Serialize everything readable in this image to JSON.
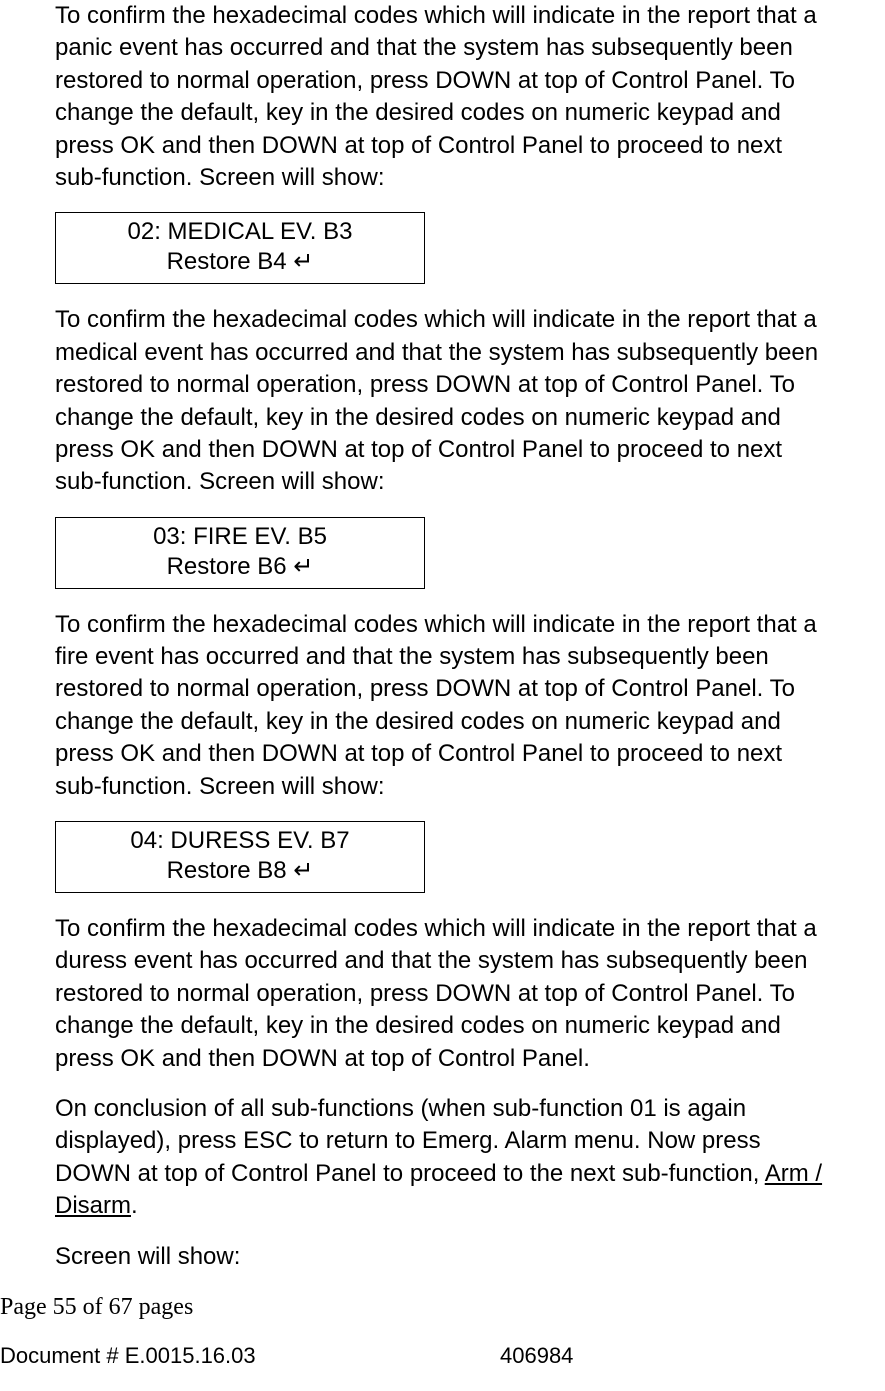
{
  "paragraphs": {
    "p1": "To confirm the hexadecimal codes which will indicate in the report that a panic event has occurred and that the system has subsequently been restored to normal operation, press DOWN at top of Control Panel. To change the default, key in the desired codes on numeric keypad and press OK and then DOWN at top of Control Panel to proceed to next sub-function. Screen will show:",
    "p2": "To confirm the hexadecimal codes which will indicate in the report that a medical event has occurred and that the system has subsequently been restored to normal operation, press DOWN at top of Control Panel. To change the default, key in the desired codes on numeric keypad and press OK and then DOWN at top of Control Panel to proceed to next sub-function. Screen will show:",
    "p3": "To confirm the hexadecimal codes which will indicate in the report that a fire event has occurred and that the system has subsequently been restored to normal operation, press DOWN at top of Control Panel. To change the default, key in the desired codes on numeric keypad and press OK and then DOWN at top of Control Panel to proceed to next sub-function. Screen will show:",
    "p4": "To confirm the hexadecimal codes which will indicate in the report that a duress event has occurred and that the system has subsequently been restored to normal operation, press DOWN at top of Control Panel. To change the default, key in the desired codes on numeric keypad and press OK and then DOWN at top of Control Panel.",
    "p5a": "On conclusion of all sub-functions (when sub-function 01 is again displayed), press ESC to return to Emerg. Alarm menu. Now press DOWN at top of Control Panel to proceed to the next sub-function, ",
    "p5b": "Arm / Disarm",
    "p5c": ".",
    "p6": "Screen will show:"
  },
  "screens": {
    "s1": {
      "line1": "02: MEDICAL EV. B3",
      "line2": "Restore B4    ↵"
    },
    "s2": {
      "line1": "03: FIRE EV. B5",
      "line2": "Restore B6    ↵"
    },
    "s3": {
      "line1": "04: DURESS EV. B7",
      "line2": "Restore B8    ↵"
    }
  },
  "footer": {
    "page": "Page 55 of  67 pages",
    "doc": "Document # E.0015.16.03",
    "right": "406984"
  }
}
